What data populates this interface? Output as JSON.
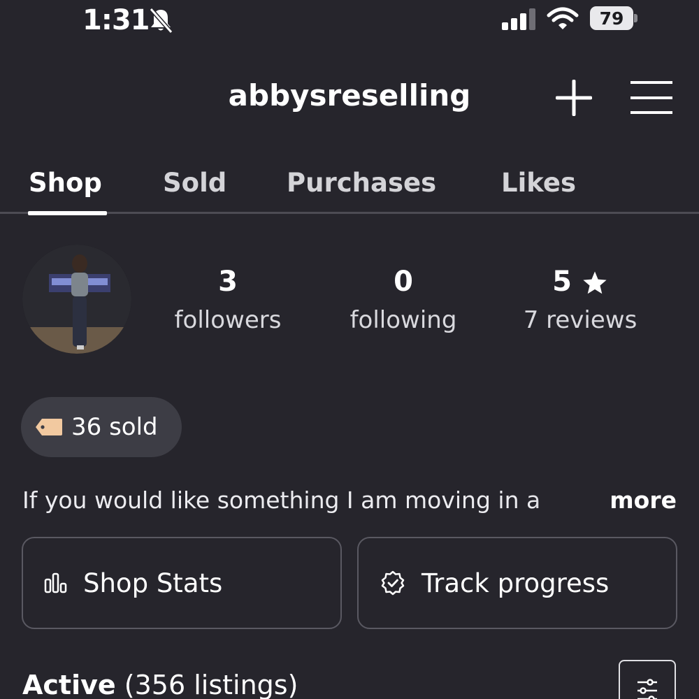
{
  "status_bar": {
    "time": "1:31",
    "battery": "79"
  },
  "header": {
    "username": "abbysreselling",
    "icons": [
      "plus-icon",
      "hamburger-menu-icon"
    ]
  },
  "tabs": [
    {
      "label": "Shop",
      "active": true
    },
    {
      "label": "Sold",
      "active": false
    },
    {
      "label": "Purchases",
      "active": false
    },
    {
      "label": "Likes",
      "active": false
    }
  ],
  "profile": {
    "stats": [
      {
        "value": "3",
        "label": "followers"
      },
      {
        "value": "0",
        "label": "following"
      },
      {
        "value": "5",
        "label": "7 reviews",
        "icon": "star-icon"
      }
    ],
    "sold_badge": "36 sold",
    "bio": "If you would like something I am moving in a",
    "more_label": "more"
  },
  "actions": {
    "shop_stats": "Shop Stats",
    "track_progress": "Track progress"
  },
  "listings": {
    "heading": "Active",
    "count": "(356 listings)"
  },
  "colors": {
    "background": "#26252c",
    "badge_background": "#3d3d45",
    "tag_icon": "#f2c9a0"
  }
}
